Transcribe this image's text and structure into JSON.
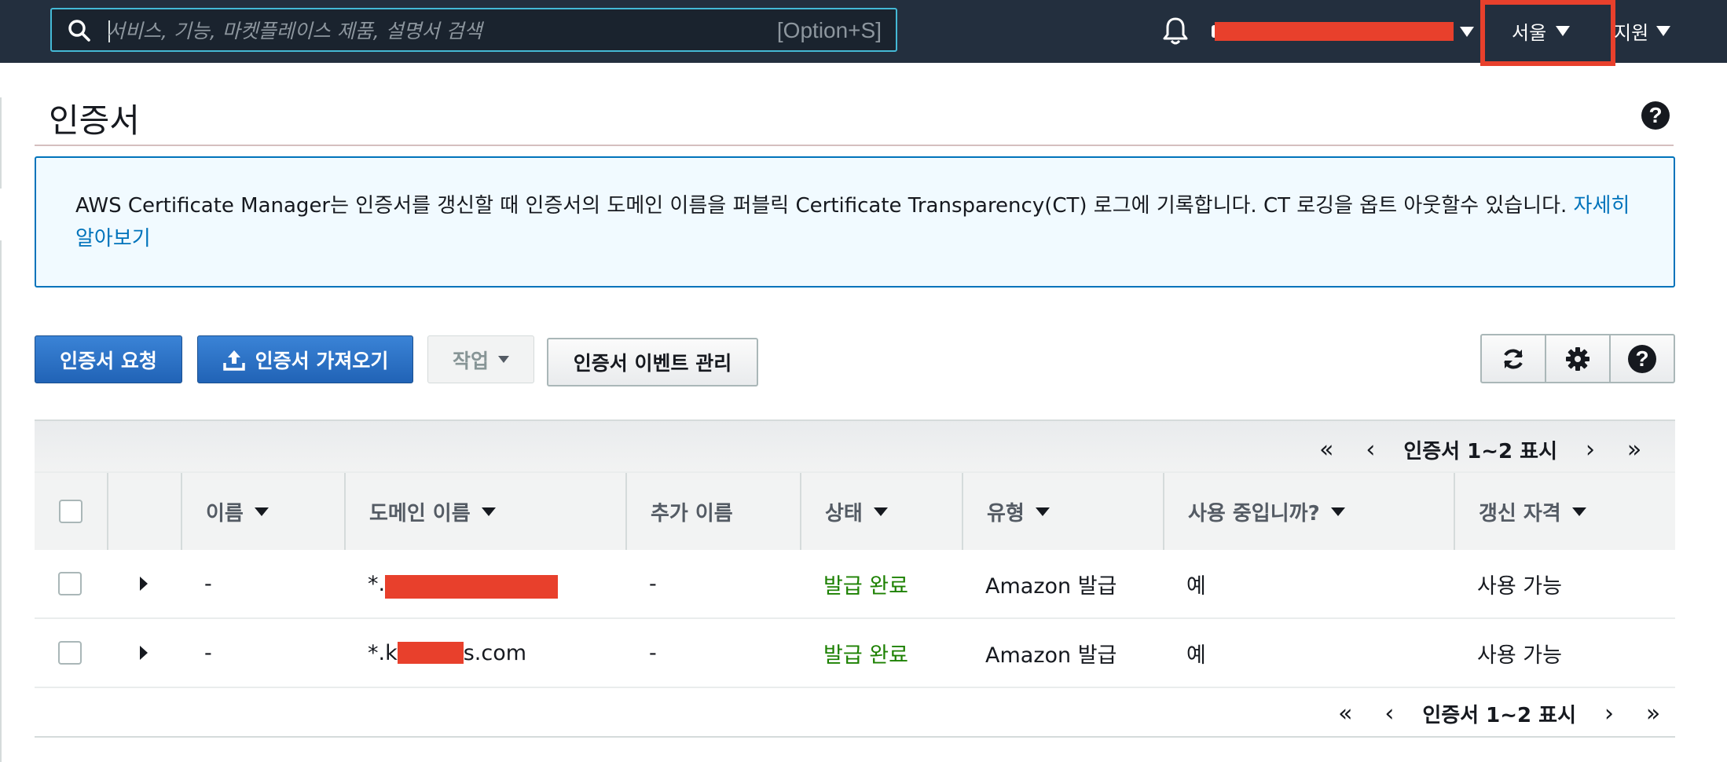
{
  "topbar": {
    "search_placeholder": "서비스, 기능, 마켓플레이스 제품, 설명서 검색",
    "search_shortcut": "[Option+S]",
    "region_label": "서울",
    "support_label": "지원"
  },
  "page": {
    "title": "인증서",
    "help": "?"
  },
  "info_banner": {
    "text": "AWS Certificate Manager는 인증서를 갱신할 때 인증서의 도메인 이름을 퍼블릭 Certificate Transparency(CT) 로그에 기록합니다. CT 로깅을 옵트 아웃할수 있습니다. ",
    "link": "자세히 알아보기"
  },
  "toolbar": {
    "request_label": "인증서 요청",
    "import_label": "인증서 가져오기",
    "actions_label": "작업",
    "events_label": "인증서 이벤트 관리",
    "help": "?"
  },
  "pager": {
    "first": "«",
    "prev": "‹",
    "label": "인증서 1~2 표시",
    "next": "›",
    "last": "»"
  },
  "table": {
    "columns": [
      "이름",
      "도메인 이름",
      "추가 이름",
      "상태",
      "유형",
      "사용 중입니까?",
      "갱신 자격"
    ],
    "rows": [
      {
        "name": "-",
        "domain_prefix": "*.",
        "domain_suffix": "",
        "additional": "-",
        "status": "발급 완료",
        "type": "Amazon 발급",
        "in_use": "예",
        "renewal": "사용 가능"
      },
      {
        "name": "-",
        "domain_prefix": "*.k",
        "domain_suffix": "s.com",
        "additional": "-",
        "status": "발급 완료",
        "type": "Amazon 발급",
        "in_use": "예",
        "renewal": "사용 가능"
      }
    ]
  },
  "colors": {
    "nav_bg": "#232f3e",
    "primary": "#2b6ec2",
    "link": "#0073bb",
    "success": "#1d8102",
    "redaction": "#e8402c"
  }
}
